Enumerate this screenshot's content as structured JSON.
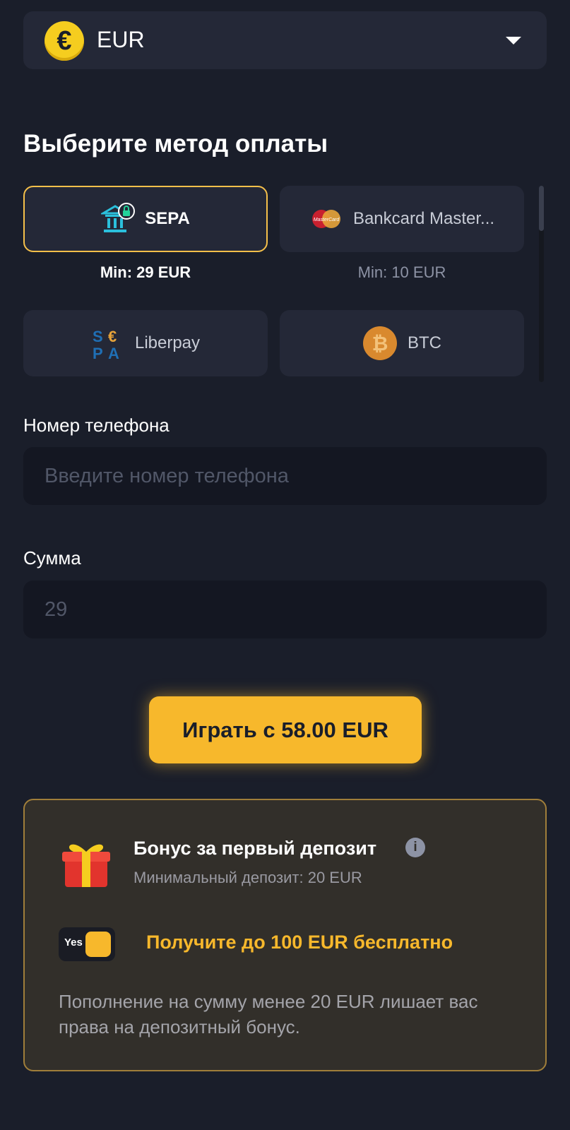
{
  "currency": {
    "label": "EUR",
    "symbol": "€"
  },
  "payment": {
    "heading": "Выберите метод оплаты",
    "methods": [
      {
        "label": "SEPA",
        "icon": "bank-lock-icon",
        "min": "Min: 29 EUR",
        "selected": true
      },
      {
        "label": "Bankcard Master...",
        "icon": "mastercard-icon",
        "min": "Min: 10 EUR",
        "selected": false
      },
      {
        "label": "Liberpay",
        "icon": "sepa-logo-icon",
        "selected": false
      },
      {
        "label": "BTC",
        "icon": "bitcoin-icon",
        "selected": false
      }
    ]
  },
  "form": {
    "phone_label": "Номер телефона",
    "phone_placeholder": "Введите номер телефона",
    "amount_label": "Сумма",
    "amount_value": "29"
  },
  "play_button": "Играть с 58.00 EUR",
  "bonus": {
    "title": "Бонус за первый депозит",
    "info_icon": "i",
    "subtitle": "Минимальный депозит: 20 EUR",
    "toggle_label": "Yes",
    "offer": "Получите до 100 EUR бесплатно",
    "note": "Пополнение на сумму менее 20 EUR лишает вас права на депозитный бонус."
  },
  "colors": {
    "accent": "#f7b82c",
    "background": "#1a1e2a",
    "card": "#242837"
  }
}
